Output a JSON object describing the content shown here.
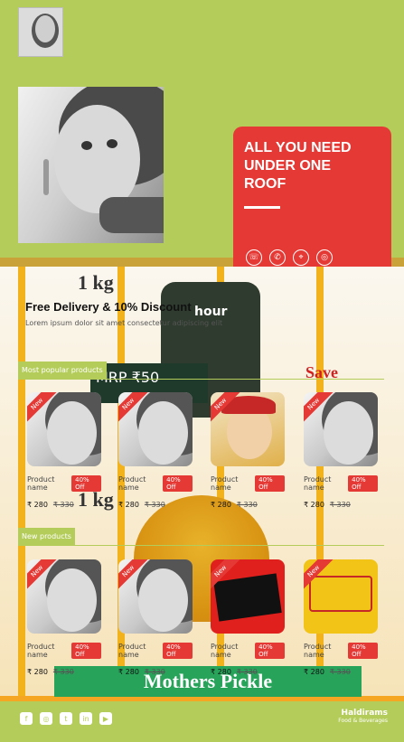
{
  "promo": {
    "title": "ALL YOU NEED UNDER ONE ROOF",
    "icons": [
      "phone-icon",
      "whatsapp-icon",
      "location-icon",
      "globe-icon"
    ]
  },
  "banner": {
    "weight_1": "1 kg",
    "weight_2": "1 kg",
    "bag_brand": "hour",
    "price_tag": "MRP ₹50",
    "save": "Save",
    "pickle": "Mothers Pickle"
  },
  "delivery": {
    "title": "Free Delivery & 10% Discount",
    "subtitle": "Lorem ipsum dolor sit amet consectetur adipiscing elit"
  },
  "sections": [
    {
      "title": "Most popular products",
      "products": [
        {
          "badge": "New",
          "name": "Product name",
          "discount": "40% Off",
          "price": "₹ 280",
          "old_price": "₹ 330"
        },
        {
          "badge": "New",
          "name": "Product name",
          "discount": "40% Off",
          "price": "₹ 280",
          "old_price": "₹ 330"
        },
        {
          "badge": "New",
          "name": "Product name",
          "discount": "40% Off",
          "price": "₹ 280",
          "old_price": "₹ 330"
        },
        {
          "badge": "New",
          "name": "Product name",
          "discount": "40% Off",
          "price": "₹ 280",
          "old_price": "₹ 330"
        }
      ]
    },
    {
      "title": "New products",
      "products": [
        {
          "badge": "New",
          "name": "Product name",
          "discount": "40% Off",
          "price": "₹ 280",
          "old_price": "₹ 330"
        },
        {
          "badge": "New",
          "name": "Product name",
          "discount": "40% Off",
          "price": "₹ 280",
          "old_price": "₹ 330"
        },
        {
          "badge": "New",
          "name": "Product name",
          "discount": "40% Off",
          "price": "₹ 280",
          "old_price": "₹ 330"
        },
        {
          "badge": "New",
          "name": "Product name",
          "discount": "40% Off",
          "price": "₹ 280",
          "old_price": "₹ 330"
        }
      ]
    }
  ],
  "footer": {
    "social_icons": [
      "facebook-icon",
      "instagram-icon",
      "twitter-icon",
      "linkedin-icon",
      "youtube-icon"
    ],
    "brand_name": "Haldirams",
    "brand_sub": "Food & Beverages"
  },
  "colors": {
    "accent_green": "#b4cc5a",
    "accent_red": "#e53935"
  }
}
